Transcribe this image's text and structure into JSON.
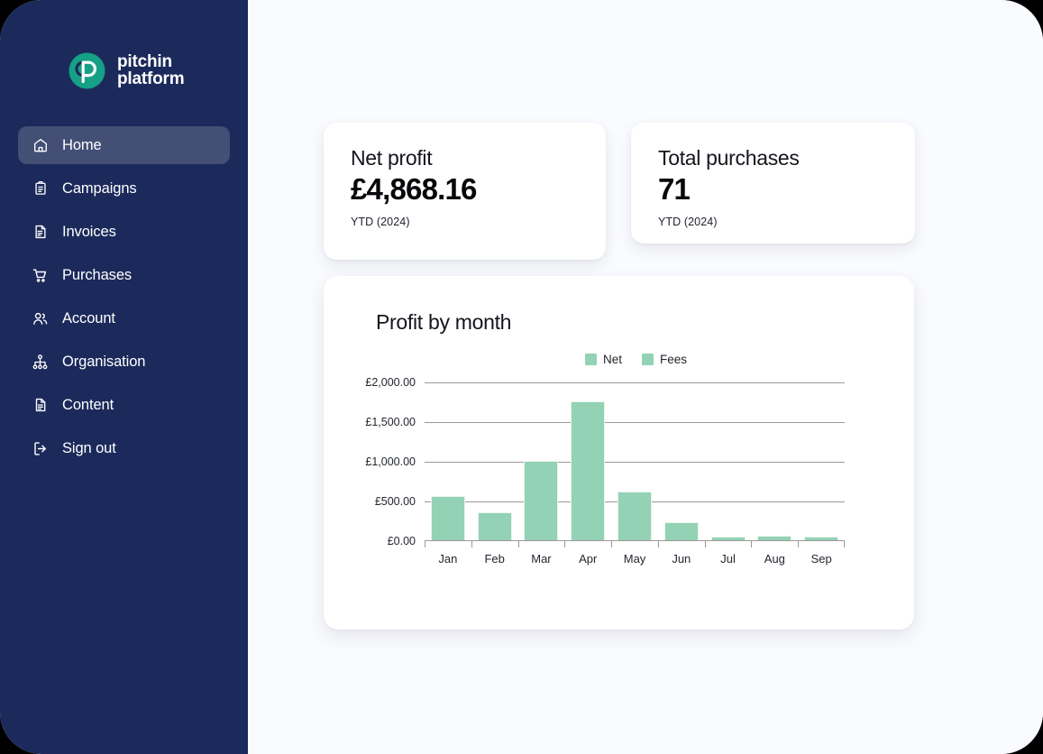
{
  "brand": {
    "name_line1": "pitchin",
    "name_line2": "platform",
    "logo_icon": "pitchin-logo-icon",
    "logo_color": "#16A085",
    "sidebar_bg": "#1B2A5B",
    "active_item_bg": "#434F75"
  },
  "sidebar": {
    "items": [
      {
        "label": "Home",
        "icon": "home-icon",
        "active": true
      },
      {
        "label": "Campaigns",
        "icon": "clipboard-icon",
        "active": false
      },
      {
        "label": "Invoices",
        "icon": "invoice-icon",
        "active": false
      },
      {
        "label": "Purchases",
        "icon": "cart-icon",
        "active": false
      },
      {
        "label": "Account",
        "icon": "users-icon",
        "active": false
      },
      {
        "label": "Organisation",
        "icon": "org-chart-icon",
        "active": false
      },
      {
        "label": "Content",
        "icon": "document-icon",
        "active": false
      },
      {
        "label": "Sign out",
        "icon": "sign-out-icon",
        "active": false
      }
    ]
  },
  "stats": [
    {
      "title": "Net profit",
      "value": "£4,868.16",
      "sub": "YTD (2024)"
    },
    {
      "title": "Total purchases",
      "value": "71",
      "sub": "YTD (2024)"
    }
  ],
  "chart_data": {
    "type": "bar",
    "title": "Profit by month",
    "xlabel": "",
    "ylabel": "",
    "ylim": [
      0,
      2000
    ],
    "grid": true,
    "legend_position": "top-center",
    "bar_color": "#93D2B4",
    "categories": [
      "Jan",
      "Feb",
      "Mar",
      "Apr",
      "May",
      "Jun",
      "Jul",
      "Aug",
      "Sep"
    ],
    "ytick_labels": [
      "£0.00",
      "£500.00",
      "£1,000.00",
      "£1,500.00",
      "£2,000.00"
    ],
    "ytick_values": [
      0,
      500,
      1000,
      1500,
      2000
    ],
    "series": [
      {
        "name": "Net",
        "color": "#93D2B4",
        "values": [
          560,
          355,
          1000,
          1745,
          615,
          230,
          30,
          60,
          35
        ]
      },
      {
        "name": "Fees",
        "color": "#93D2B4",
        "values": [
          560,
          355,
          1000,
          1745,
          615,
          230,
          30,
          60,
          35
        ]
      }
    ]
  }
}
